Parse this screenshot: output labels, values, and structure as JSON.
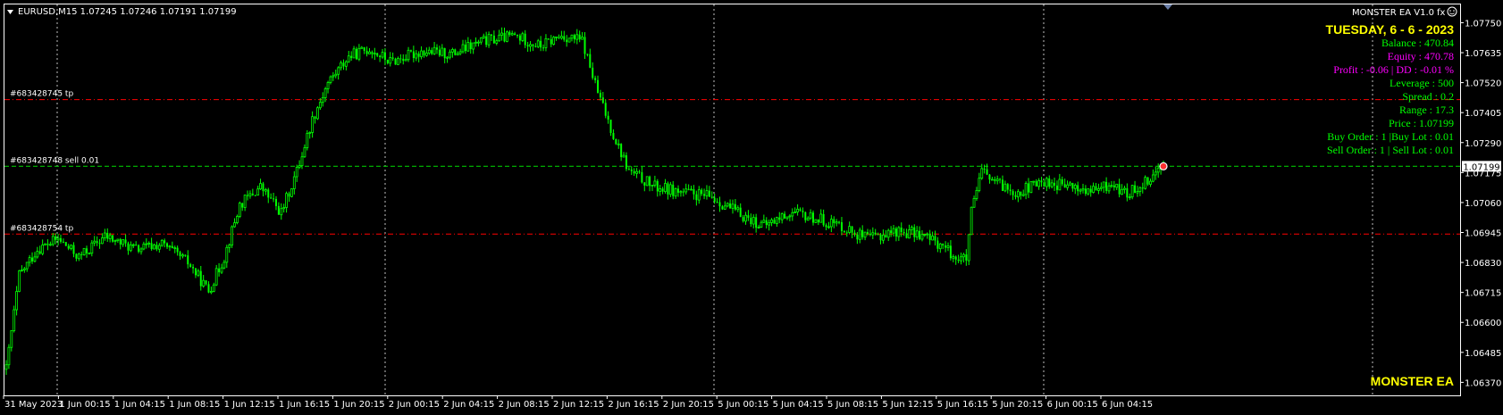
{
  "symbol_label": "EURUSD,M15  1.07245 1.07246 1.07191 1.07199",
  "ea_name": "MONSTER EA V1.0",
  "ea_suffix": "fx",
  "ea_icon": "smiley-icon",
  "brand_label": "MONSTER EA",
  "info": {
    "date": "TUESDAY, 6 - 6 - 2023",
    "balance": "Balance  : 470.84",
    "equity": "Equity    : 470.78",
    "profit": "Profit : -0.06 | DD : -0.01 %",
    "leverage": "Leverage  : 500",
    "spread": "Spread  : 0.2",
    "range": "Range  : 17.3",
    "price": "Price : 1.07199",
    "buy": "Buy Order : 1 |Buy Lot : 0.01",
    "sell": "Sell Order : 1 | Sell Lot : 0.01"
  },
  "colors": {
    "background": "#000000",
    "candle": "#00ff00",
    "grid": "#c0c0c0",
    "order_line": "#00c000",
    "tp_line": "#ff0000",
    "date_text": "#ffff00",
    "info_green": "#00ff00",
    "info_magenta": "#ff00ff",
    "brand_text": "#ffff00",
    "price_box_bg": "#ffffff",
    "price_box_text": "#000000"
  },
  "chart_data": {
    "type": "candlestick",
    "y_ticks": [
      "1.07750",
      "1.07635",
      "1.07520",
      "1.07405",
      "1.07290",
      "1.07175",
      "1.07060",
      "1.06945",
      "1.06830",
      "1.06715",
      "1.06600",
      "1.06485",
      "1.06370"
    ],
    "ylim": [
      1.0632,
      1.0782
    ],
    "x_labels": [
      "31 May 2023",
      "1 Jun 00:15",
      "1 Jun 04:15",
      "1 Jun 08:15",
      "1 Jun 12:15",
      "1 Jun 16:15",
      "1 Jun 20:15",
      "2 Jun 00:15",
      "2 Jun 04:15",
      "2 Jun 08:15",
      "2 Jun 12:15",
      "2 Jun 16:15",
      "2 Jun 20:15",
      "5 Jun 00:15",
      "5 Jun 04:15",
      "5 Jun 08:15",
      "5 Jun 12:15",
      "5 Jun 16:15",
      "5 Jun 20:15",
      "6 Jun 00:15",
      "6 Jun 04:15"
    ],
    "current_price": "1.07199",
    "grid": true,
    "order_lines": [
      {
        "label": "#683428745 tp",
        "price": 1.07455,
        "style": "tp"
      },
      {
        "label": "#683428748 sell 0.01",
        "price": 1.07199,
        "style": "order"
      },
      {
        "label": "#683428754 tp",
        "price": 1.06939,
        "style": "tp"
      }
    ],
    "key_points": [
      [
        0,
        1.0642
      ],
      [
        5,
        1.0678
      ],
      [
        12,
        1.0688
      ],
      [
        20,
        1.0692
      ],
      [
        28,
        1.0685
      ],
      [
        38,
        1.0693
      ],
      [
        50,
        1.0688
      ],
      [
        60,
        1.069
      ],
      [
        70,
        1.0683
      ],
      [
        78,
        1.0672
      ],
      [
        84,
        1.0685
      ],
      [
        90,
        1.0705
      ],
      [
        98,
        1.0712
      ],
      [
        106,
        1.0702
      ],
      [
        112,
        1.0718
      ],
      [
        118,
        1.0738
      ],
      [
        124,
        1.0752
      ],
      [
        132,
        1.0762
      ],
      [
        140,
        1.0765
      ],
      [
        148,
        1.076
      ],
      [
        160,
        1.0764
      ],
      [
        172,
        1.0763
      ],
      [
        184,
        1.0768
      ],
      [
        196,
        1.077
      ],
      [
        206,
        1.0766
      ],
      [
        214,
        1.077
      ],
      [
        222,
        1.0768
      ],
      [
        228,
        1.0748
      ],
      [
        234,
        1.0732
      ],
      [
        240,
        1.0718
      ],
      [
        250,
        1.0712
      ],
      [
        260,
        1.071
      ],
      [
        272,
        1.0708
      ],
      [
        282,
        1.0702
      ],
      [
        292,
        1.0697
      ],
      [
        302,
        1.0702
      ],
      [
        312,
        1.07
      ],
      [
        322,
        1.0697
      ],
      [
        332,
        1.0692
      ],
      [
        342,
        1.0695
      ],
      [
        352,
        1.0694
      ],
      [
        360,
        1.069
      ],
      [
        366,
        1.0685
      ],
      [
        370,
        1.0684
      ],
      [
        372,
        1.0702
      ],
      [
        376,
        1.0718
      ],
      [
        382,
        1.0713
      ],
      [
        390,
        1.071
      ],
      [
        400,
        1.0714
      ],
      [
        410,
        1.0712
      ],
      [
        418,
        1.071
      ],
      [
        426,
        1.0713
      ],
      [
        432,
        1.0709
      ],
      [
        440,
        1.0715
      ],
      [
        446,
        1.07199
      ]
    ]
  }
}
